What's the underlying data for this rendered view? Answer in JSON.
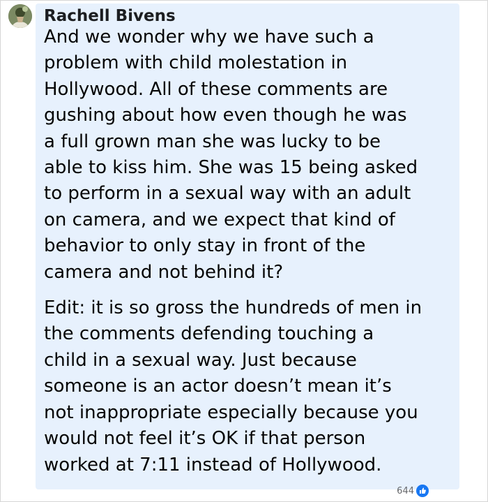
{
  "comment": {
    "author": "Rachell Bivens",
    "paragraphs": [
      "And we wonder why we have such a\nproblem with child molestation in\nHollywood. All of these comments are\ngushing about how even though he was\na full grown man she was lucky to be\nable to kiss him. She was 15 being asked\nto perform in a sexual way with an adult\non camera, and we expect that kind of\nbehavior to only stay in front of the\ncamera and not behind it?",
      "Edit: it is so gross the hundreds of men in\nthe comments defending touching a\nchild in a sexual way. Just because\nsomeone is an actor doesn’t mean it’s\nnot inappropriate especially because you\nwould not feel it’s OK if that person\nworked at 7:11 instead of Hollywood."
    ],
    "reaction_count": "644",
    "reaction_icon": "like-icon",
    "colors": {
      "bubble": "#e7f1fd",
      "like": "#1877f2"
    }
  }
}
